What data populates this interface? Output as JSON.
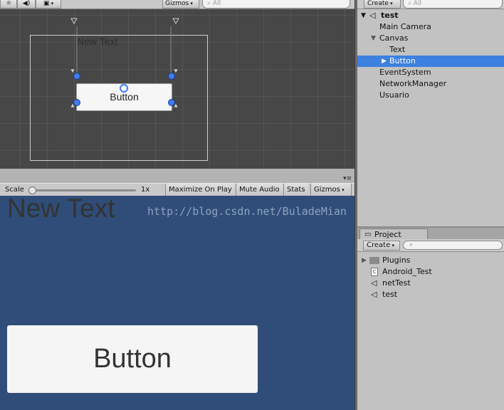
{
  "scene": {
    "toolbar": {
      "gizmos_label": "Gizmos",
      "search_placeholder": "All"
    },
    "canvas_text": "New Text",
    "button_text": "Button"
  },
  "game": {
    "toolbar": {
      "scale_label": "Scale",
      "scale_value": "1x",
      "maximize_label": "Maximize On Play",
      "mute_label": "Mute Audio",
      "stats_label": "Stats",
      "gizmos_label": "Gizmos"
    },
    "canvas_text": "New Text",
    "button_text": "Button"
  },
  "watermark": "http://blog.csdn.net/BuladeMian",
  "hierarchy": {
    "create_label": "Create",
    "search_placeholder": "All",
    "scene_name": "test",
    "items": [
      {
        "label": "Main Camera"
      },
      {
        "label": "Canvas"
      },
      {
        "label": "Text"
      },
      {
        "label": "Button"
      },
      {
        "label": "EventSystem"
      },
      {
        "label": "NetworkManager"
      },
      {
        "label": "Usuario"
      }
    ],
    "selection_color": "#3d80df"
  },
  "project": {
    "tab_label": "Project",
    "create_label": "Create",
    "items": [
      {
        "label": "Plugins",
        "icon": "folder-icon"
      },
      {
        "label": "Android_Test",
        "icon": "csharp-script-icon"
      },
      {
        "label": "netTest",
        "icon": "unity-scene-icon"
      },
      {
        "label": "test",
        "icon": "unity-scene-icon"
      }
    ]
  }
}
